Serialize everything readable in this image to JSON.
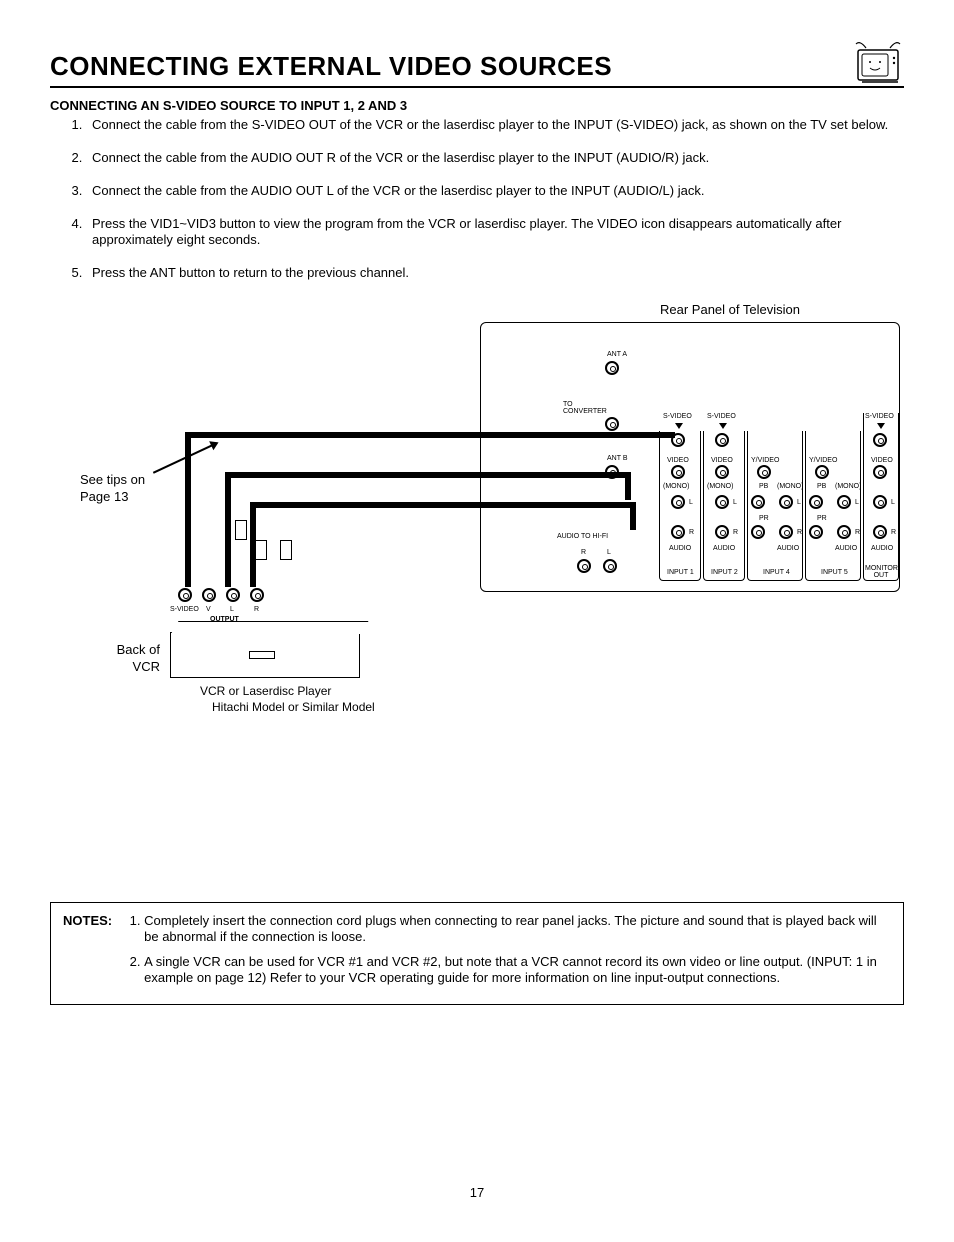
{
  "header": {
    "title": "CONNECTING EXTERNAL VIDEO SOURCES"
  },
  "section": {
    "subheading": "CONNECTING AN S-VIDEO SOURCE TO INPUT 1, 2 AND 3",
    "steps": [
      "Connect the cable from the S-VIDEO OUT of the VCR or the laserdisc player to the INPUT (S-VIDEO) jack, as shown on the TV set below.",
      "Connect the cable from the AUDIO OUT R of the VCR or the laserdisc player to the INPUT (AUDIO/R) jack.",
      "Connect the cable from the AUDIO OUT L of the VCR or the laserdisc player to the INPUT (AUDIO/L) jack.",
      "Press the VID1~VID3 button to view the program from the VCR or laserdisc player.  The VIDEO icon disappears automatically after approximately eight seconds.",
      "Press the ANT button to return to the previous channel."
    ]
  },
  "diagram": {
    "rear_panel_title": "Rear Panel of Television",
    "see_tips": "See tips on Page 13",
    "back_of_vcr": "Back of VCR",
    "vcr_caption1": "VCR or Laserdisc Player",
    "vcr_caption2": "Hitachi Model or Similar Model",
    "vcr_out_svideo": "S-VIDEO",
    "vcr_out_v": "V",
    "vcr_out_l": "L",
    "vcr_out_r": "R",
    "vcr_out_label": "OUTPUT",
    "ant_a": "ANT A",
    "ant_b": "ANT B",
    "to_converter": "TO CONVERTER",
    "audio_to_hifi": "AUDIO TO HI-FI",
    "hifi_r": "R",
    "hifi_l": "L",
    "col_svideo": "S-VIDEO",
    "col_video": "VIDEO",
    "col_yvideo": "Y/VIDEO",
    "col_mono": "(MONO)",
    "col_l": "L",
    "col_r": "R",
    "col_pb": "PB",
    "col_pr": "PR",
    "col_audio": "AUDIO",
    "input1": "INPUT 1",
    "input2": "INPUT 2",
    "input4": "INPUT 4",
    "input5": "INPUT 5",
    "monitor_out": "MONITOR OUT"
  },
  "notes": {
    "label": "NOTES:",
    "items": [
      "Completely insert the connection cord plugs when connecting to rear panel jacks.  The picture and sound that is played back will be abnormal if the connection is loose.",
      "A single VCR can be used for VCR #1 and VCR #2, but note that a VCR cannot record its own video or line output.  (INPUT: 1 in example on page 12)  Refer to your VCR operating guide for more information on line input-output connections."
    ]
  },
  "page_number": "17"
}
